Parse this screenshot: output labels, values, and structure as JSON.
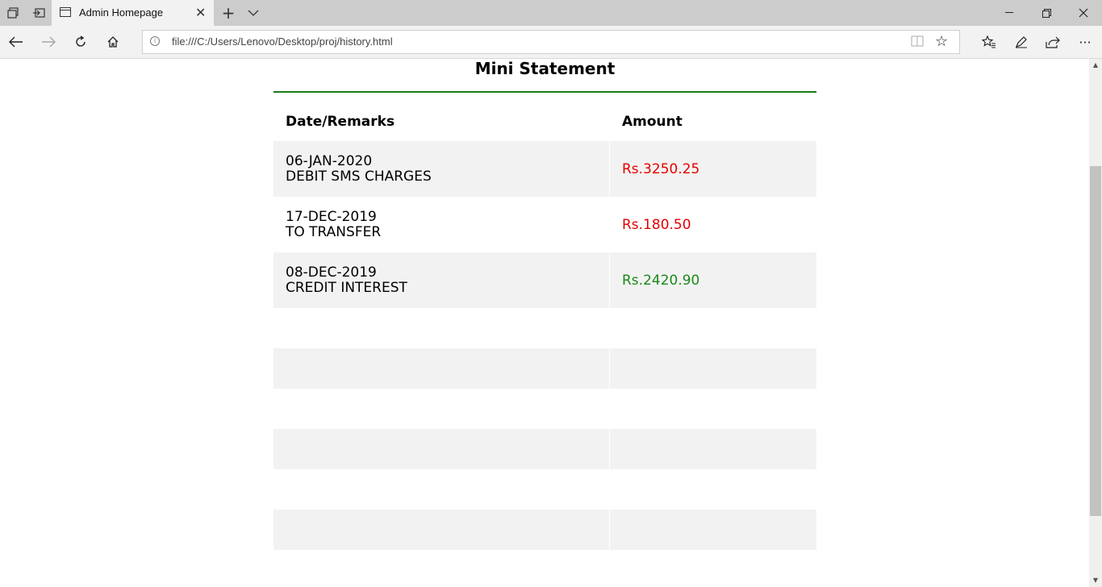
{
  "browser": {
    "tab_title": "Admin Homepage",
    "url": "file:///C:/Users/Lenovo/Desktop/proj/history.html"
  },
  "page": {
    "title": "Mini Statement",
    "accent_color": "#1a7a1a",
    "debit_color": "#e60000",
    "credit_color": "#1a8a1a"
  },
  "table": {
    "headers": [
      "Date/Remarks",
      "Amount"
    ],
    "rows": [
      {
        "date": "06-JAN-2020",
        "remark": "DEBIT SMS CHARGES",
        "amount": "Rs.3250.25",
        "type": "debit"
      },
      {
        "date": "17-DEC-2019",
        "remark": "TO TRANSFER",
        "amount": "Rs.180.50",
        "type": "debit"
      },
      {
        "date": "08-DEC-2019",
        "remark": "CREDIT INTEREST",
        "amount": "Rs.2420.90",
        "type": "credit"
      }
    ]
  }
}
